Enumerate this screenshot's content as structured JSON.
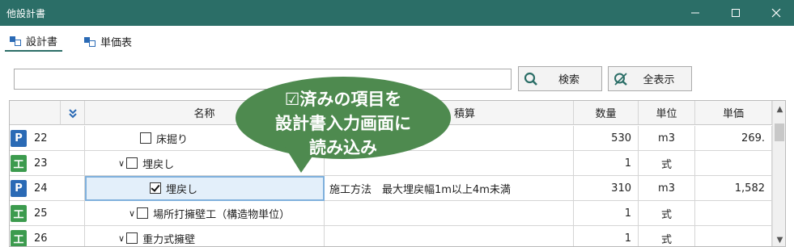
{
  "window": {
    "title": "他設計書",
    "controls": [
      "minimize",
      "maximize",
      "close"
    ]
  },
  "tabs": [
    {
      "label": "設計書",
      "icon": "document-icon",
      "active": true
    },
    {
      "label": "単価表",
      "icon": "document-icon",
      "active": false
    }
  ],
  "search": {
    "value": "",
    "button_label": "検索",
    "showall_label": "全表示"
  },
  "grid": {
    "columns": {
      "expand": "»",
      "name": "名称",
      "spec": "規格・積算",
      "quantity": "数量",
      "unit": "単位",
      "price": "単価"
    },
    "rows": [
      {
        "type": "P",
        "no": "22",
        "indent": 0,
        "chevron": "",
        "checked": false,
        "name": "床掘り",
        "spec": "",
        "quantity": "530",
        "unit": "m3",
        "price": "269."
      },
      {
        "type": "工",
        "no": "23",
        "indent": 1,
        "chevron": "∨",
        "checked": false,
        "name": "埋戻し",
        "spec": "",
        "quantity": "1",
        "unit": "式",
        "price": ""
      },
      {
        "type": "P",
        "no": "24",
        "indent": 2,
        "chevron": "",
        "checked": true,
        "name": "埋戻し",
        "spec": "施工方法　最大埋戻幅1m以上4m未満",
        "quantity": "310",
        "unit": "m3",
        "price": "1,582"
      },
      {
        "type": "工",
        "no": "25",
        "indent": 0,
        "chevron": "∨",
        "checked": false,
        "name": "場所打擁壁工（構造物単位）",
        "spec": "",
        "quantity": "1",
        "unit": "式",
        "price": ""
      },
      {
        "type": "工",
        "no": "26",
        "indent": 1,
        "chevron": "∨",
        "checked": false,
        "name": "重力式擁壁",
        "spec": "",
        "quantity": "1",
        "unit": "式",
        "price": ""
      }
    ]
  },
  "callout": {
    "line1": "☑済みの項目を",
    "line2": "設計書入力画面に",
    "line3": "読み込み",
    "color": "#4e8a4f"
  },
  "colors": {
    "titlebar": "#2b6e67",
    "badge_P": "#2a6ab5",
    "badge_K": "#3c9b4e"
  }
}
